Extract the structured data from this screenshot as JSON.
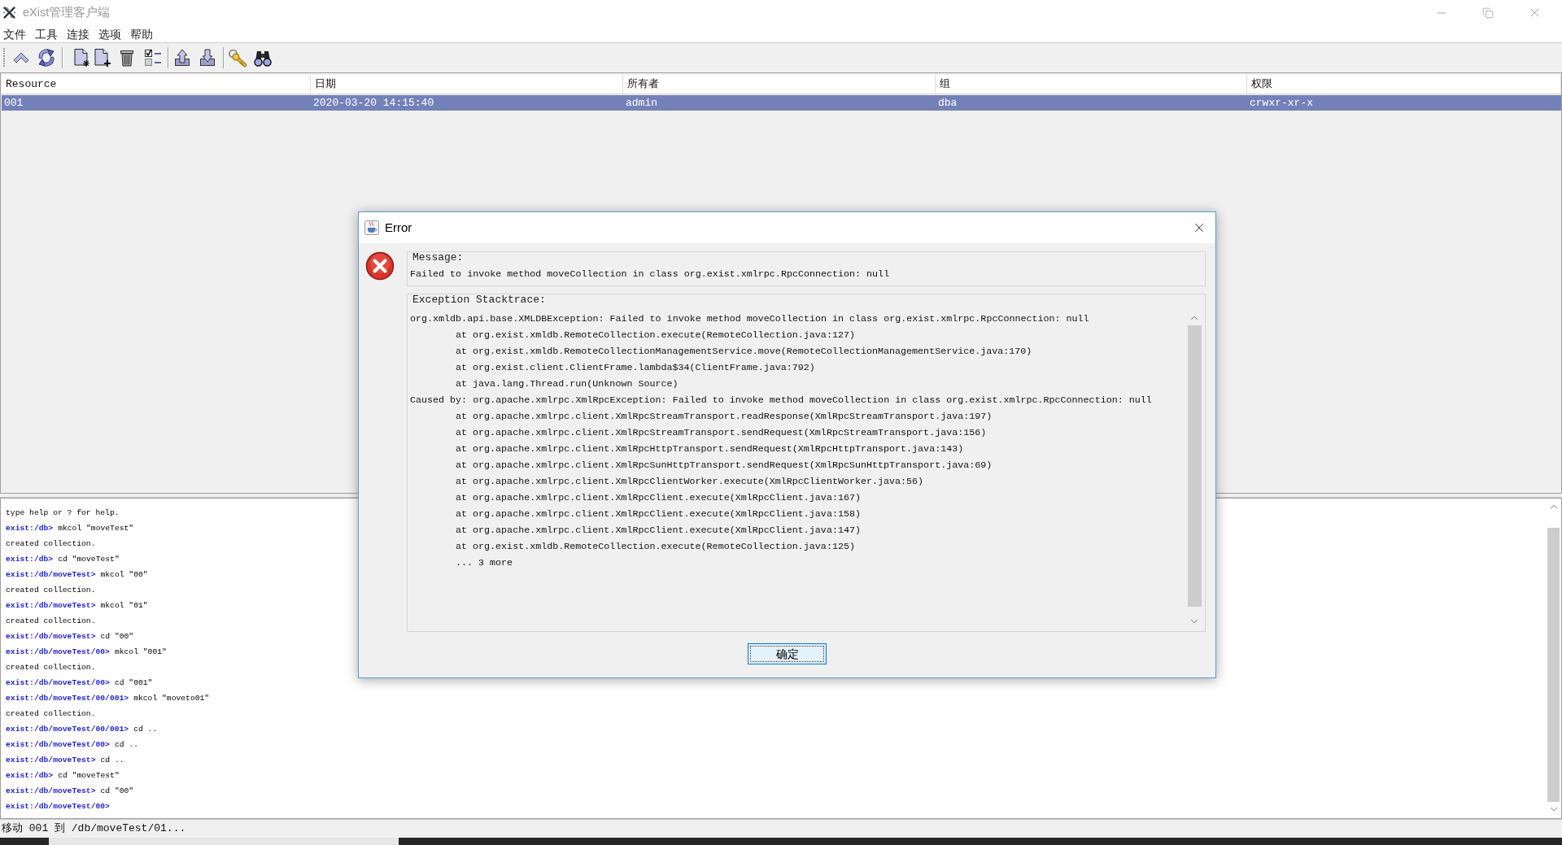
{
  "window": {
    "title": "eXist管理客户端"
  },
  "menu": [
    "文件",
    "工具",
    "连接",
    "选项",
    "帮助"
  ],
  "table": {
    "columns": [
      "Resource",
      "日期",
      "所有者",
      "组",
      "权限"
    ],
    "rows": [
      {
        "selected": true,
        "cells": [
          "001",
          "2020-03-20 14:15:40",
          "admin",
          "dba",
          "crwxr-xr-x"
        ]
      }
    ]
  },
  "console": {
    "lines": [
      {
        "kind": "output",
        "text": "type help or ? for help."
      },
      {
        "kind": "command",
        "prompt": "exist:/db>",
        "text": "mkcol \"moveTest\""
      },
      {
        "kind": "output",
        "text": "created collection."
      },
      {
        "kind": "command",
        "prompt": "exist:/db>",
        "text": "cd \"moveTest\""
      },
      {
        "kind": "command",
        "prompt": "exist:/db/moveTest>",
        "text": "mkcol \"00\""
      },
      {
        "kind": "output",
        "text": "created collection."
      },
      {
        "kind": "command",
        "prompt": "exist:/db/moveTest>",
        "text": "mkcol \"01\""
      },
      {
        "kind": "output",
        "text": "created collection."
      },
      {
        "kind": "command",
        "prompt": "exist:/db/moveTest>",
        "text": "cd \"00\""
      },
      {
        "kind": "command",
        "prompt": "exist:/db/moveTest/00>",
        "text": "mkcol \"001\""
      },
      {
        "kind": "output",
        "text": "created collection."
      },
      {
        "kind": "command",
        "prompt": "exist:/db/moveTest/00>",
        "text": "cd \"001\""
      },
      {
        "kind": "command",
        "prompt": "exist:/db/moveTest/00/001>",
        "text": "mkcol \"moveto01\""
      },
      {
        "kind": "output",
        "text": "created collection."
      },
      {
        "kind": "command",
        "prompt": "exist:/db/moveTest/00/001>",
        "text": "cd .."
      },
      {
        "kind": "command",
        "prompt": "exist:/db/moveTest/00>",
        "text": "cd .."
      },
      {
        "kind": "command",
        "prompt": "exist:/db/moveTest>",
        "text": "cd .."
      },
      {
        "kind": "command",
        "prompt": "exist:/db>",
        "text": "cd \"moveTest\""
      },
      {
        "kind": "command",
        "prompt": "exist:/db/moveTest>",
        "text": "cd \"00\""
      },
      {
        "kind": "command",
        "prompt": "exist:/db/moveTest/00>"
      }
    ]
  },
  "status_bar": {
    "text": "移动 001 到 /db/moveTest/01..."
  },
  "dialog": {
    "title": "Error",
    "message_label": "Message:",
    "message": "Failed to invoke method moveCollection in class org.exist.xmlrpc.RpcConnection: null",
    "stacktrace_label": "Exception Stacktrace:",
    "stacktrace": [
      {
        "kind": "head",
        "text": "org.xmldb.api.base.XMLDBException: Failed to invoke method moveCollection in class org.exist.xmlrpc.RpcConnection: null"
      },
      {
        "kind": "frame",
        "text": "at org.exist.xmldb.RemoteCollection.execute(RemoteCollection.java:127)"
      },
      {
        "kind": "frame",
        "text": "at org.exist.xmldb.RemoteCollectionManagementService.move(RemoteCollectionManagementService.java:170)"
      },
      {
        "kind": "frame",
        "text": "at org.exist.client.ClientFrame.lambda$34(ClientFrame.java:792)"
      },
      {
        "kind": "frame",
        "text": "at java.lang.Thread.run(Unknown Source)"
      },
      {
        "kind": "head",
        "text": "Caused by: org.apache.xmlrpc.XmlRpcException: Failed to invoke method moveCollection in class org.exist.xmlrpc.RpcConnection: null"
      },
      {
        "kind": "frame",
        "text": "at org.apache.xmlrpc.client.XmlRpcStreamTransport.readResponse(XmlRpcStreamTransport.java:197)"
      },
      {
        "kind": "frame",
        "text": "at org.apache.xmlrpc.client.XmlRpcStreamTransport.sendRequest(XmlRpcStreamTransport.java:156)"
      },
      {
        "kind": "frame",
        "text": "at org.apache.xmlrpc.client.XmlRpcHttpTransport.sendRequest(XmlRpcHttpTransport.java:143)"
      },
      {
        "kind": "frame",
        "text": "at org.apache.xmlrpc.client.XmlRpcSunHttpTransport.sendRequest(XmlRpcSunHttpTransport.java:69)"
      },
      {
        "kind": "frame",
        "text": "at org.apache.xmlrpc.client.XmlRpcClientWorker.execute(XmlRpcClientWorker.java:56)"
      },
      {
        "kind": "frame",
        "text": "at org.apache.xmlrpc.client.XmlRpcClient.execute(XmlRpcClient.java:167)"
      },
      {
        "kind": "frame",
        "text": "at org.apache.xmlrpc.client.XmlRpcClient.execute(XmlRpcClient.java:158)"
      },
      {
        "kind": "frame",
        "text": "at org.apache.xmlrpc.client.XmlRpcClient.execute(XmlRpcClient.java:147)"
      },
      {
        "kind": "frame",
        "text": "at org.exist.xmldb.RemoteCollection.execute(RemoteCollection.java:125)"
      },
      {
        "kind": "frame",
        "text": "... 3 more"
      }
    ],
    "button": "确定"
  }
}
